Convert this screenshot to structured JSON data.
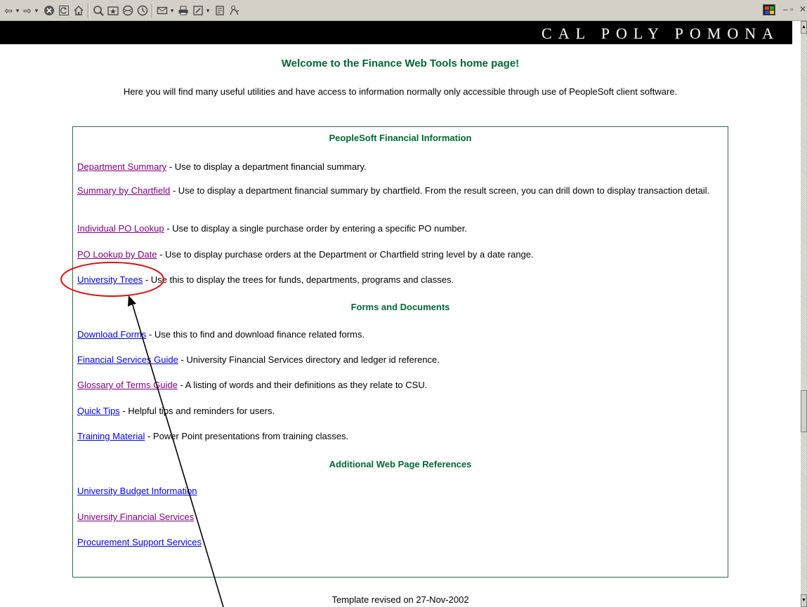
{
  "toolbar": {
    "buttons": [
      "back-icon",
      "forward-icon",
      "stop-icon",
      "refresh-icon",
      "home-icon",
      "search-icon",
      "favorites-icon",
      "media-icon",
      "history-icon",
      "mail-icon",
      "print-icon",
      "edit-icon",
      "discuss-icon",
      "messenger-icon"
    ],
    "back_glyph": "⇦",
    "forward_glyph": "⇨",
    "dropdown_glyph": "▾",
    "minimize_glyph": "–",
    "restore_glyph": "▫",
    "close_glyph": "✕"
  },
  "banner": {
    "text": "CAL POLY POMONA"
  },
  "welcome": "Welcome to the Finance Web Tools home page!",
  "intro": "Here you will find many useful utilities and have access to information normally only accessible through use of PeopleSoft client software.",
  "sections": {
    "peoplesoft": {
      "title": "PeopleSoft Financial Information",
      "items": [
        {
          "link": "Department Summary",
          "desc": " - Use to display a department financial summary.",
          "visited": true
        },
        {
          "link": "Summary by Chartfield",
          "desc": " - Use to display a department financial summary by chartfield. From the result screen, you can drill down to display transaction detail.",
          "visited": true
        },
        {
          "link": "Individual PO Lookup",
          "desc": " - Use to display a single purchase order by entering a specific PO number.",
          "visited": true
        },
        {
          "link": "PO Lookup by Date",
          "desc": " - Use to display purchase orders at the Department or Chartfield string level by a date range.",
          "visited": true
        },
        {
          "link": "University Trees",
          "desc": " - Use this to display the trees for funds, departments, programs and classes.",
          "visited": false
        }
      ]
    },
    "forms": {
      "title": "Forms and Documents",
      "items": [
        {
          "link": "Download Forms",
          "desc": " - Use this to find and download finance related forms.",
          "visited": false
        },
        {
          "link": "Financial Services Guide",
          "desc": " - University Financial Services directory and ledger id reference.",
          "visited": false
        },
        {
          "link": "Glossary of Terms Guide",
          "desc": " - A listing of words and their definitions as they relate to CSU.",
          "visited": true
        },
        {
          "link": "Quick Tips",
          "desc": " - Helpful tips and reminders for users.",
          "visited": false
        },
        {
          "link": "Training Material",
          "desc": " - Power Point presentations from training classes.",
          "visited": false
        }
      ]
    },
    "additional": {
      "title": "Additional Web Page References",
      "items": [
        {
          "link": "University Budget Information",
          "desc": "",
          "visited": false
        },
        {
          "link": "University Financial Services",
          "desc": "",
          "visited": true
        },
        {
          "link": "Procurement Support Services",
          "desc": "",
          "visited": false
        }
      ]
    }
  },
  "footer": "Template revised on 27-Nov-2002",
  "colors": {
    "heading_green": "#006633",
    "banner_bg": "#000000",
    "panel_border": "#2e6a4a",
    "link_unvisited": "#0000ee",
    "link_visited": "#800080",
    "annotation_red": "#e01010"
  }
}
